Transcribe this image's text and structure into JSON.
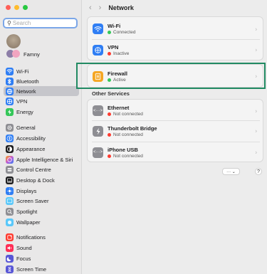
{
  "window": {
    "title": "Network",
    "nav_back": "‹",
    "nav_forward": "›"
  },
  "search": {
    "placeholder": "Search",
    "value": ""
  },
  "sidebar": {
    "family_label": "Famny",
    "items": [
      {
        "label": "Wi-Fi",
        "icon": "wifi-icon",
        "color": "#2f7ef4",
        "selected": false
      },
      {
        "label": "Bluetooth",
        "icon": "bluetooth-icon",
        "color": "#2f7ef4",
        "selected": false
      },
      {
        "label": "Network",
        "icon": "globe-icon",
        "color": "#2f7ef4",
        "selected": true
      },
      {
        "label": "VPN",
        "icon": "globe-lock-icon",
        "color": "#2f7ef4",
        "selected": false
      },
      {
        "label": "Energy",
        "icon": "bolt-icon",
        "color": "#35c759",
        "selected": false
      },
      {
        "label": "General",
        "icon": "gear-icon",
        "color": "#8e8e93",
        "selected": false
      },
      {
        "label": "Accessibility",
        "icon": "accessibility-icon",
        "color": "#2f7ef4",
        "selected": false
      },
      {
        "label": "Appearance",
        "icon": "appearance-icon",
        "color": "#1c1c1e",
        "selected": false
      },
      {
        "label": "Apple Intelligence & Siri",
        "icon": "siri-icon",
        "color": "#c15bd8",
        "selected": false
      },
      {
        "label": "Control Centre",
        "icon": "control-centre-icon",
        "color": "#8e8e93",
        "selected": false
      },
      {
        "label": "Desktop & Dock",
        "icon": "dock-icon",
        "color": "#1c1c1e",
        "selected": false
      },
      {
        "label": "Displays",
        "icon": "sun-icon",
        "color": "#2f7ef4",
        "selected": false
      },
      {
        "label": "Screen Saver",
        "icon": "screen-saver-icon",
        "color": "#5ac8fa",
        "selected": false
      },
      {
        "label": "Spotlight",
        "icon": "search-icon",
        "color": "#8e8e93",
        "selected": false
      },
      {
        "label": "Wallpaper",
        "icon": "wallpaper-icon",
        "color": "#5ac8fa",
        "selected": false
      },
      {
        "label": "Notifications",
        "icon": "bell-icon",
        "color": "#ff3b30",
        "selected": false
      },
      {
        "label": "Sound",
        "icon": "speaker-icon",
        "color": "#ff2d55",
        "selected": false
      },
      {
        "label": "Focus",
        "icon": "moon-icon",
        "color": "#5856d6",
        "selected": false
      },
      {
        "label": "Screen Time",
        "icon": "hourglass-icon",
        "color": "#5856d6",
        "selected": false
      }
    ]
  },
  "services": [
    {
      "name": "Wi-Fi",
      "status": "Connected",
      "status_color": "#34c759",
      "icon": "wifi-icon",
      "icon_color": "#2f7ef4"
    },
    {
      "name": "VPN",
      "status": "Inactive",
      "status_color": "#ff3b30",
      "icon": "globe-lock-icon",
      "icon_color": "#2f7ef4"
    },
    {
      "name": "Firewall",
      "status": "Active",
      "status_color": "#34c759",
      "icon": "firewall-icon",
      "icon_color": "#f5a623"
    }
  ],
  "other_services": {
    "title": "Other Services",
    "items": [
      {
        "name": "Ethernet",
        "status": "Not connected",
        "status_color": "#ff3b30",
        "icon": "ethernet-icon"
      },
      {
        "name": "Thunderbolt Bridge",
        "status": "Not connected",
        "status_color": "#ff3b30",
        "icon": "thunderbolt-icon"
      },
      {
        "name": "iPhone USB",
        "status": "Not connected",
        "status_color": "#ff3b30",
        "icon": "ethernet-icon"
      }
    ]
  },
  "footer": {
    "more_label": "··· ⌄",
    "help_label": "?"
  },
  "colors": {
    "accent": "#2f7ef4",
    "highlight_box": "#218a62"
  }
}
